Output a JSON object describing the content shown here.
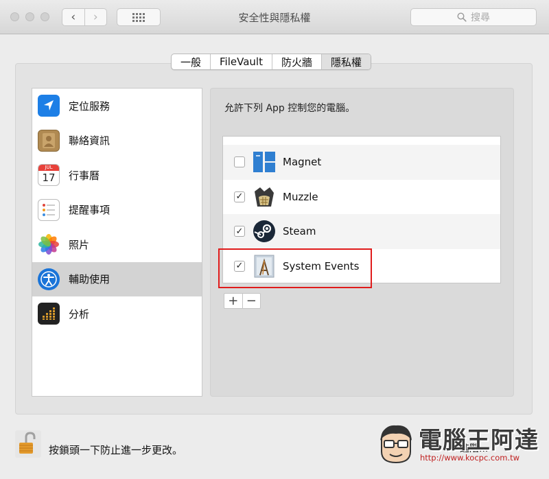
{
  "window": {
    "title": "安全性與隱私權",
    "search_placeholder": "搜尋",
    "back_icon": "‹",
    "forward_icon": "›"
  },
  "tabs": [
    {
      "label": "一般",
      "active": false
    },
    {
      "label": "FileVault",
      "active": false
    },
    {
      "label": "防火牆",
      "active": false
    },
    {
      "label": "隱私權",
      "active": true
    }
  ],
  "sidebar": {
    "items": [
      {
        "label": "定位服務",
        "icon": "location-arrow-icon",
        "selected": false
      },
      {
        "label": "聯絡資訊",
        "icon": "contacts-book-icon",
        "selected": false
      },
      {
        "label": "行事曆",
        "icon": "calendar-icon",
        "selected": false,
        "icon_month": "JUL",
        "icon_day": "17"
      },
      {
        "label": "提醒事項",
        "icon": "reminders-icon",
        "selected": false
      },
      {
        "label": "照片",
        "icon": "photos-icon",
        "selected": false
      },
      {
        "label": "輔助使用",
        "icon": "accessibility-icon",
        "selected": true
      },
      {
        "label": "分析",
        "icon": "analytics-icon",
        "selected": false
      }
    ]
  },
  "main": {
    "prompt": "允許下列 App 控制您的電腦。",
    "apps": [
      {
        "name": "Magnet",
        "checked": false,
        "icon": "magnet-app-icon"
      },
      {
        "name": "Muzzle",
        "checked": true,
        "icon": "muzzle-app-icon"
      },
      {
        "name": "Steam",
        "checked": true,
        "icon": "steam-app-icon"
      },
      {
        "name": "System Events",
        "checked": true,
        "icon": "system-events-app-icon"
      }
    ],
    "add_label": "+",
    "remove_label": "−",
    "check_mark": "✓"
  },
  "footer": {
    "lock_text": "按鎖頭一下防止進一步更改。",
    "advanced_label": "進階..."
  },
  "watermark": {
    "title": "電腦王阿達",
    "url": "http://www.kocpc.com.tw"
  },
  "colors": {
    "highlight_border": "#e01b1b",
    "location_blue": "#1d7fe6",
    "accessibility_blue": "#1a74d8"
  }
}
